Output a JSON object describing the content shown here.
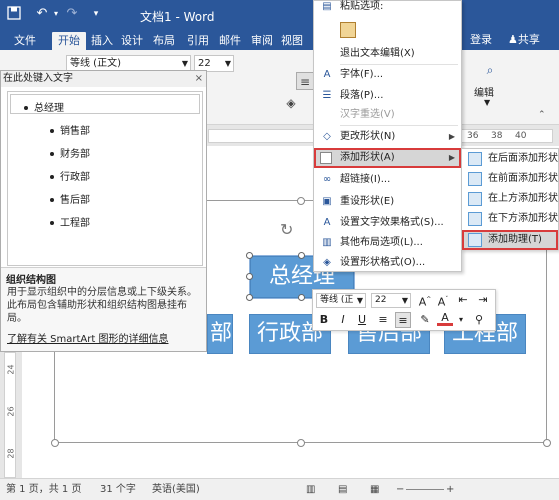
{
  "titlebar": {
    "title": "文档1 - Word",
    "save_icon": "save-icon",
    "undo_icon": "undo-icon",
    "redo_icon": "redo-icon",
    "qat_more_icon": "customize-qat-icon"
  },
  "tabs": {
    "items": [
      "文件",
      "开始",
      "插入",
      "设计",
      "布局",
      "引用",
      "邮件",
      "审阅",
      "视图"
    ],
    "active": "开始",
    "login": "登录",
    "share": "共享"
  },
  "ribbon": {
    "font_name": "等线 (正文)",
    "font_size": "22",
    "edit_group": "编辑"
  },
  "ruler": {
    "h_numbers": [
      "36",
      "38",
      "40"
    ],
    "v_numbers": [
      "24",
      "26",
      "28"
    ]
  },
  "text_pane": {
    "header": "在此处键入文字",
    "close_label": "×",
    "items": [
      "总经理",
      "销售部",
      "财务部",
      "行政部",
      "售后部",
      "工程部"
    ],
    "desc_title": "组织结构图",
    "desc_body": "用于显示组织中的分层信息或上下级关系。此布局包含辅助形状和组织结构图悬挂布局。",
    "link": "了解有关 SmartArt 图形的详细信息"
  },
  "diagram": {
    "top_box": "总经理",
    "boxes": [
      "部",
      "行政部",
      "售后部",
      "工程部"
    ]
  },
  "context_menu": {
    "paste_options": "粘贴选项:",
    "items": [
      {
        "label": "退出文本编辑(X)",
        "icon": "exit-edit-icon",
        "disabled": false
      },
      {
        "label": "字体(F)...",
        "icon": "font-icon",
        "disabled": false
      },
      {
        "label": "段落(P)...",
        "icon": "paragraph-icon",
        "disabled": false
      },
      {
        "label": "汉字重选(V)",
        "icon": "reconvert-icon",
        "disabled": true
      },
      {
        "label": "更改形状(N)",
        "icon": "change-shape-icon",
        "disabled": false,
        "submenu": true
      },
      {
        "label": "添加形状(A)",
        "icon": "add-shape-icon",
        "disabled": false,
        "submenu": true,
        "highlighted": true
      },
      {
        "label": "超链接(I)...",
        "icon": "hyperlink-icon",
        "disabled": false
      },
      {
        "label": "重设形状(E)",
        "icon": "reset-shape-icon",
        "disabled": false
      },
      {
        "label": "设置文字效果格式(S)...",
        "icon": "text-effects-icon",
        "disabled": false
      },
      {
        "label": "其他布局选项(L)...",
        "icon": "layout-options-icon",
        "disabled": false
      },
      {
        "label": "设置形状格式(O)...",
        "icon": "format-shape-icon",
        "disabled": false
      }
    ]
  },
  "submenu": {
    "items": [
      {
        "label": "在后面添加形状",
        "highlighted": false
      },
      {
        "label": "在前面添加形状",
        "highlighted": false
      },
      {
        "label": "在上方添加形状",
        "highlighted": false
      },
      {
        "label": "在下方添加形状",
        "highlighted": false
      },
      {
        "label": "添加助理(T)",
        "highlighted": true
      }
    ]
  },
  "minibar": {
    "font_name": "等线 (正",
    "font_size": "22",
    "bold": "B",
    "italic": "I",
    "underline": "U",
    "font_color": "A"
  },
  "status": {
    "page": "第 1 页，共 1 页",
    "words": "31 个字",
    "language": "英语(美国)"
  },
  "colors": {
    "accent": "#2b579a",
    "shape_fill": "#5b9bd5",
    "highlight_border": "#d83b3b"
  }
}
